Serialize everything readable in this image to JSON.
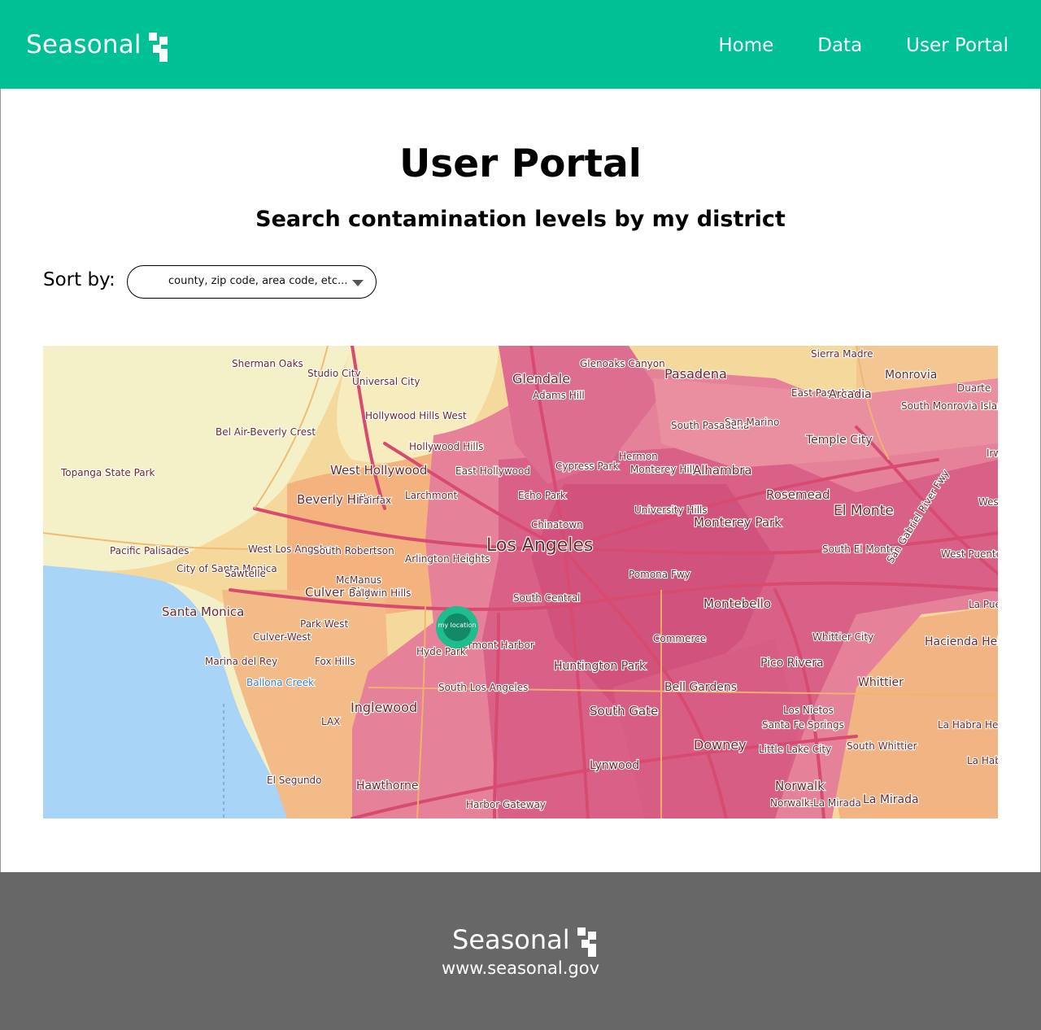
{
  "header": {
    "brand": "Seasonal",
    "nav": [
      {
        "label": "Home"
      },
      {
        "label": "Data"
      },
      {
        "label": "User Portal"
      }
    ]
  },
  "main": {
    "title": "User Portal",
    "subtitle": "Search contamination levels by my district",
    "sort": {
      "label": "Sort by:",
      "value": "county, zip code, area code, etc..."
    },
    "map": {
      "marker_label": "my location",
      "places": [
        "Sherman Oaks",
        "Studio City",
        "Universal City",
        "Glendale",
        "Glenoaks Canyon",
        "Pasadena",
        "Monrovia",
        "Duarte",
        "East Pasadena",
        "Arcadia",
        "South Monrovia Island",
        "Bel Air-Beverly Crest",
        "Hollywood Hills West",
        "Adams Hill",
        "South Pasadena",
        "San Marino",
        "Temple City",
        "Topanga State Park",
        "West Hollywood",
        "Hollywood Hills",
        "East Hollywood",
        "Cypress Park",
        "Hermon",
        "Monterey Hills",
        "Alhambra",
        "Beverly Hills",
        "Fairfax",
        "Larchmont",
        "Echo Park",
        "Rosemead",
        "University Hills",
        "El Monte",
        "Chinatown",
        "Monterey Park",
        "Pacific Palisades",
        "West Los Angeles",
        "South Robertson",
        "Arlington Heights",
        "Los Angeles",
        "South El Monte",
        "West Puente Valley",
        "City of Santa Monica",
        "Sawtelle",
        "McManus",
        "Pomona Fwy",
        "Culver City",
        "Baldwin Hills",
        "South Central",
        "Montebello",
        "La Puente",
        "Santa Monica",
        "Park West",
        "Commerce",
        "Whittier City",
        "Hacienda Heights",
        "Culver-West",
        "Hyde Park",
        "Vermont Harbor",
        "Marina del Rey",
        "Fox Hills",
        "Huntington Park",
        "Pico Rivera",
        "Ballona Creek",
        "Bell Gardens",
        "Whittier",
        "South Los Angeles",
        "Inglewood",
        "South Gate",
        "Los Nietos",
        "LAX",
        "Santa Fe Springs",
        "La Habra Heights",
        "Little Lake City",
        "Downey",
        "South Whittier",
        "Lynwood",
        "El Segundo",
        "Hawthorne",
        "Norwalk",
        "La Mirada",
        "Harbor Gateway",
        "Norwalk-La Mirada",
        "La Habra",
        "Sierra Madre",
        "Irwindale",
        "West Covina",
        "San Gabriel River Fwy"
      ]
    }
  },
  "footer": {
    "brand": "Seasonal",
    "url": "www.seasonal.gov"
  },
  "colors": {
    "brand_green": "#00c096",
    "footer_gray": "#676767",
    "ocean": "#a8d4f7",
    "marker": "#1dbd8e",
    "marker_core": "#138a66"
  },
  "icons": {
    "logo": "seasonal-logo-icon",
    "dropdown": "chevron-down-icon",
    "marker": "location-marker-icon"
  }
}
